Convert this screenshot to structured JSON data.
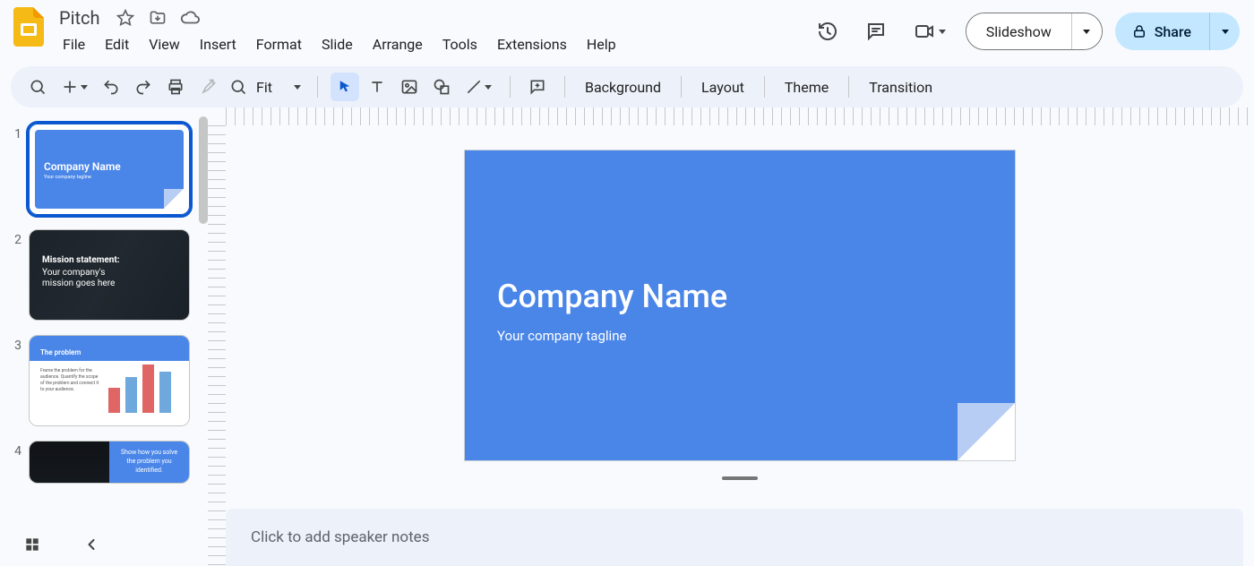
{
  "doc": {
    "title": "Pitch"
  },
  "menus": {
    "file": "File",
    "edit": "Edit",
    "view": "View",
    "insert": "Insert",
    "format": "Format",
    "slide": "Slide",
    "arrange": "Arrange",
    "tools": "Tools",
    "extensions": "Extensions",
    "help": "Help"
  },
  "header_actions": {
    "slideshow": "Slideshow",
    "share": "Share"
  },
  "toolbar": {
    "zoom_label": "Fit",
    "background": "Background",
    "layout": "Layout",
    "theme": "Theme",
    "transition": "Transition"
  },
  "slide": {
    "title": "Company Name",
    "subtitle": "Your company tagline"
  },
  "notes": {
    "placeholder": "Click to add speaker notes"
  },
  "thumbs": {
    "t1": {
      "num": "1",
      "title": "Company Name",
      "sub": "Your company tagline"
    },
    "t2": {
      "num": "2",
      "title": "Mission statement:",
      "l1": "Your company's",
      "l2": "mission goes here"
    },
    "t3": {
      "num": "3",
      "title": "The problem",
      "body": "Frame the problem for the audience.\nQuantify the scope of the problem\nand connect it to your audience."
    },
    "t4": {
      "num": "4",
      "body": "Show how you solve the\nproblem you identified."
    }
  },
  "colors": {
    "slide_bg": "#4a86e8",
    "share_bg": "#c2e7ff"
  }
}
